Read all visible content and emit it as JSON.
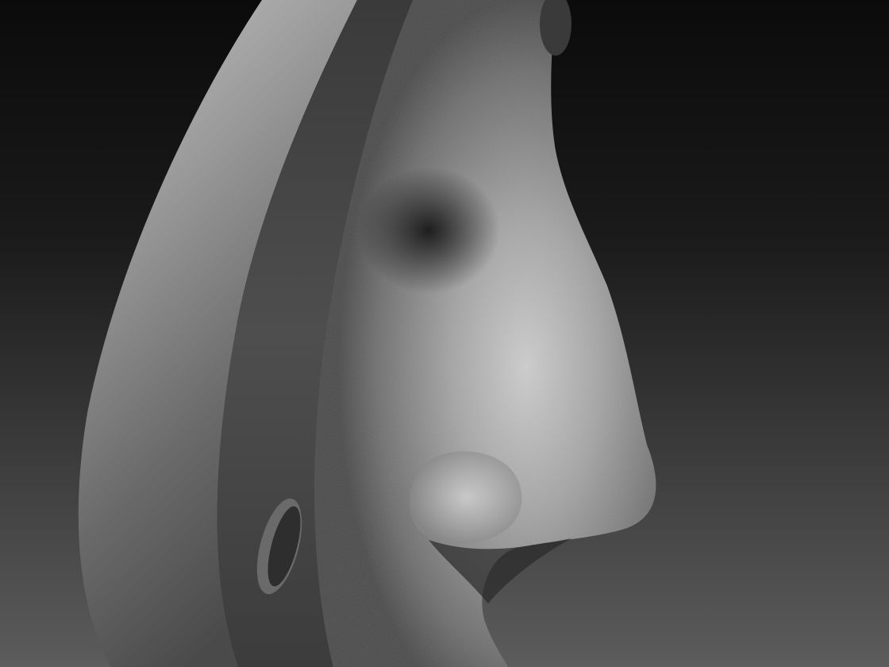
{
  "scene": {
    "subject": "sculpted-nose-mask",
    "colors": {
      "background_top": "#0c0c0c",
      "background_bottom": "#5a5a5a",
      "ring_light": "#b4b4b4",
      "ring_dark": "#2a2a2a",
      "skin_light": "#cfcfcf",
      "skin_mid": "#8a8a8a",
      "skin_shadow": "#2e2e2e"
    }
  }
}
